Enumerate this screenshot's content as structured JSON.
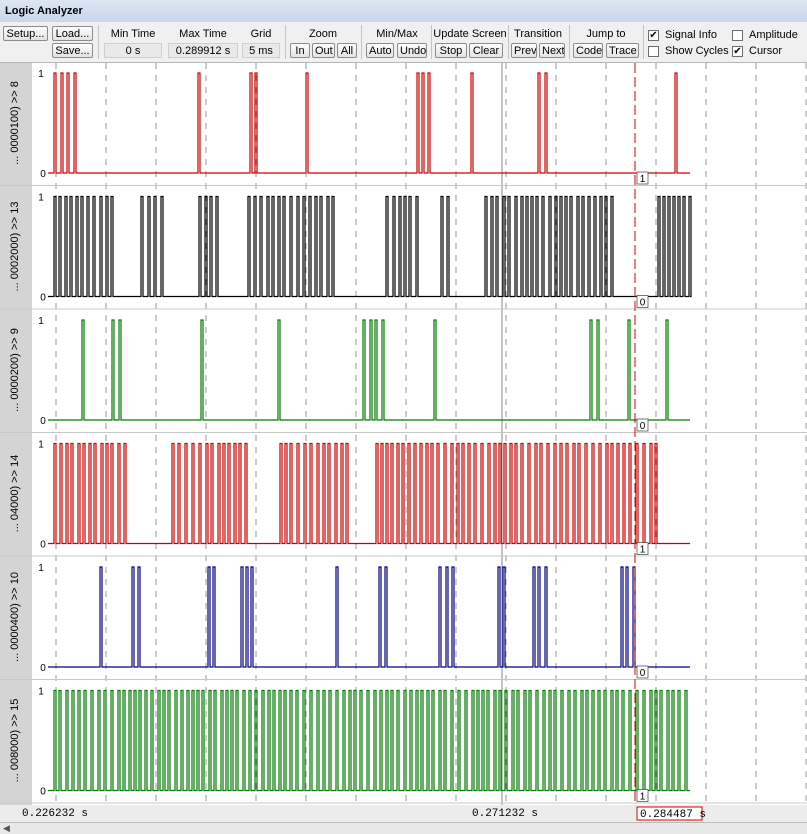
{
  "window": {
    "title": "Logic Analyzer"
  },
  "toolbar": {
    "setup": "Setup...",
    "load": "Load...",
    "save": "Save...",
    "min_time_label": "Min Time",
    "min_time_value": "0 s",
    "max_time_label": "Max Time",
    "max_time_value": "0.289912 s",
    "grid_label": "Grid",
    "grid_value": "5 ms",
    "zoom_label": "Zoom",
    "zoom_in": "In",
    "zoom_out": "Out",
    "zoom_all": "All",
    "minmax_label": "Min/Max",
    "minmax_auto": "Auto",
    "minmax_undo": "Undo",
    "update_label": "Update Screen",
    "update_stop": "Stop",
    "update_clear": "Clear",
    "transition_label": "Transition",
    "transition_prev": "Prev",
    "transition_next": "Next",
    "jump_label": "Jump to",
    "jump_code": "Code",
    "jump_trace": "Trace",
    "signal_info": {
      "label": "Signal Info",
      "checked": true
    },
    "amplitude": {
      "label": "Amplitude",
      "checked": false
    },
    "show_cycles": {
      "label": "Show Cycles",
      "checked": false
    },
    "cursor": {
      "label": "Cursor",
      "checked": true
    }
  },
  "signals": [
    {
      "name": "... 0000100) >> 8",
      "color": "#cc0000",
      "high": "1",
      "low": "0",
      "cursor_value": "1",
      "density": 0.45,
      "seed": 3
    },
    {
      "name": "... 0002000) >> 13",
      "color": "#000000",
      "high": "1",
      "low": "0",
      "cursor_value": "0",
      "density": 0.9,
      "seed": 7
    },
    {
      "name": "... 0000200) >> 9",
      "color": "#007a00",
      "high": "1",
      "low": "0",
      "cursor_value": "0",
      "density": 0.5,
      "seed": 11
    },
    {
      "name": "... 04000) >> 14",
      "color": "#cc0000",
      "high": "1",
      "low": "0",
      "cursor_value": "1",
      "density": 0.92,
      "seed": 5
    },
    {
      "name": "... 0000400) >> 10",
      "color": "#000080",
      "high": "1",
      "low": "0",
      "cursor_value": "0",
      "density": 0.55,
      "seed": 13
    },
    {
      "name": "... 008000) >> 15",
      "color": "#007a00",
      "high": "1",
      "low": "0",
      "cursor_value": "1",
      "density": 1.0,
      "seed": 2
    }
  ],
  "time_axis": {
    "left": "0.226232  s",
    "middle": "0.271232  s",
    "cursor": "0.284487  s"
  }
}
